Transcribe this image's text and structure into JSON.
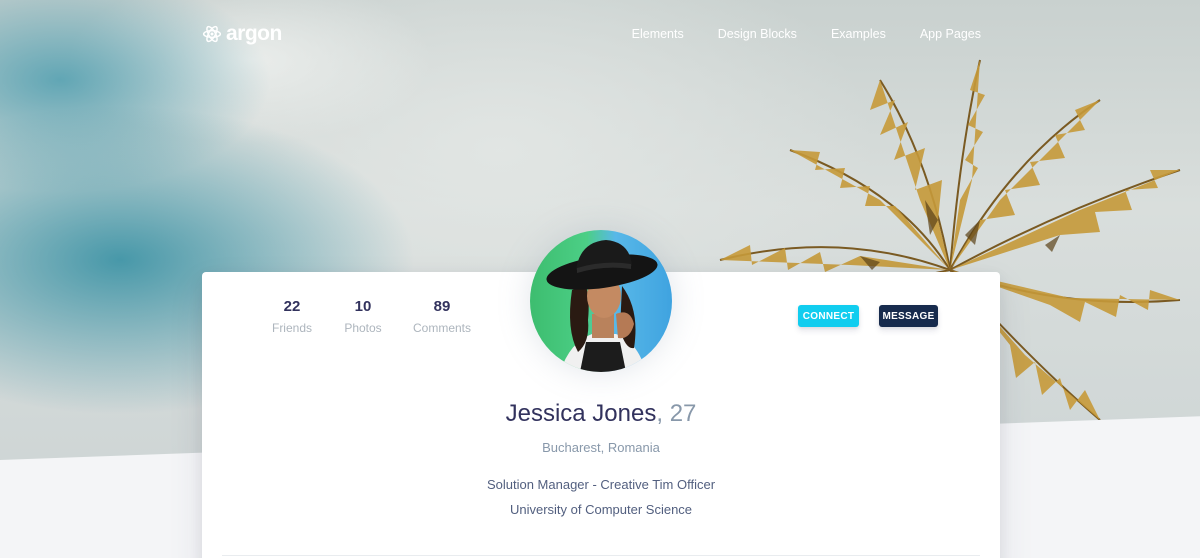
{
  "brand": {
    "name": "argon",
    "icon": "atom-icon"
  },
  "nav": {
    "items": [
      "Elements",
      "Design Blocks",
      "Examples",
      "App Pages"
    ]
  },
  "profile": {
    "stats": [
      {
        "value": "22",
        "label": "Friends"
      },
      {
        "value": "10",
        "label": "Photos"
      },
      {
        "value": "89",
        "label": "Comments"
      }
    ],
    "buttons": {
      "connect": "Connect",
      "message": "Message"
    },
    "name": "Jessica Jones",
    "age": ", 27",
    "location": "Bucharest, Romania",
    "job": "Solution Manager - Creative Tim Officer",
    "education": "University of Computer Science"
  },
  "colors": {
    "info": "#11cdef",
    "default": "#172b4d",
    "heading": "#32325d",
    "muted": "#8898aa"
  }
}
